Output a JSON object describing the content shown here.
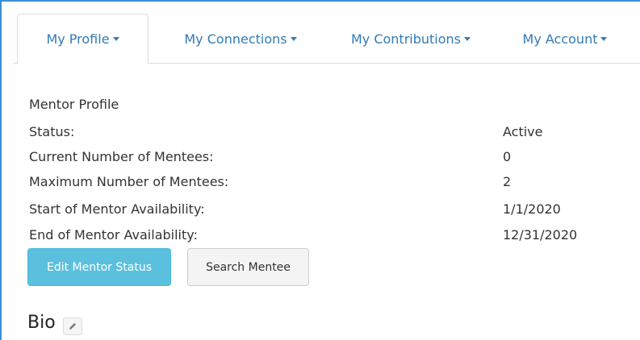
{
  "tabs": [
    {
      "label": "My Profile",
      "active": true
    },
    {
      "label": "My Connections",
      "active": false
    },
    {
      "label": "My Contributions",
      "active": false
    },
    {
      "label": "My Account",
      "active": false
    }
  ],
  "profile": {
    "section_title": "Mentor Profile",
    "rows": [
      {
        "label": "Status:",
        "value": "Active"
      },
      {
        "label": "Current Number of Mentees:",
        "value": "0"
      },
      {
        "label": "Maximum Number of Mentees:",
        "value": "2"
      },
      {
        "label": "Start of Mentor Availability:",
        "value": "1/1/2020"
      },
      {
        "label": "End of Mentor Availability:",
        "value": "12/31/2020"
      }
    ]
  },
  "buttons": {
    "edit_status": "Edit Mentor Status",
    "search_mentee": "Search Mentee"
  },
  "bio": {
    "title": "Bio",
    "edit_icon": "pencil-icon"
  },
  "colors": {
    "accent_border": "#3b8fd6",
    "link": "#337ab7",
    "primary_button": "#5bc0de"
  }
}
